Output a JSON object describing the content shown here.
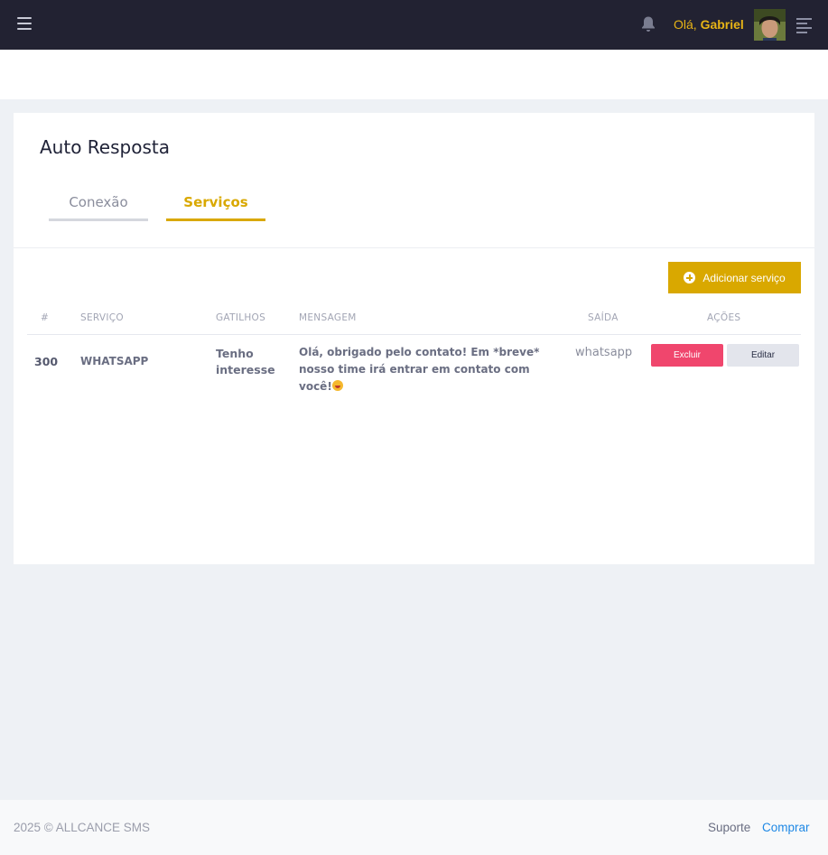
{
  "topbar": {
    "greeting_prefix": "Olá, ",
    "user_name": "Gabriel",
    "menu_icon": "hamburger-icon",
    "notification_icon": "bell-icon",
    "right_menu_icon": "align-right-icon",
    "accent_color": "#e7b416",
    "background_color": "#222232"
  },
  "page": {
    "title": "Auto Resposta",
    "tabs": [
      {
        "label": "Conexão",
        "active": false
      },
      {
        "label": "Serviços",
        "active": true
      }
    ],
    "add_button_label": "Adicionar serviço",
    "add_button_icon": "plus-circle-icon"
  },
  "table": {
    "headers": [
      "#",
      "SERVIÇO",
      "GATILHOS",
      "MENSAGEM",
      "SAÍDA",
      "AÇÕES"
    ],
    "rows": [
      {
        "id": "300",
        "service": "WHATSAPP",
        "trigger": "Tenho interesse",
        "message": "Olá, obrigado pelo contato! Em *breve* nosso time irá entrar em contato com você!",
        "message_emoji": "grinning-face-with-tongue-icon",
        "output": "whatsapp",
        "delete_label": "Excluir",
        "edit_label": "Editar"
      }
    ]
  },
  "footer": {
    "copyright": "2025 © ALLCANCE SMS",
    "support_link": "Suporte",
    "buy_link": "Comprar"
  },
  "colors": {
    "primary": "#d9a800",
    "danger": "#f0466d",
    "link": "#1e88e5"
  }
}
